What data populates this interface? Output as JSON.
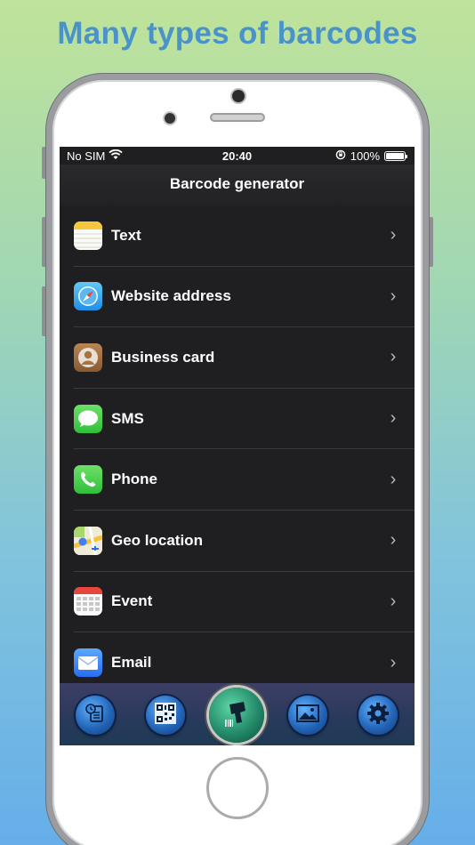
{
  "headline": "Many types of barcodes",
  "status": {
    "carrier": "No SIM",
    "time": "20:40",
    "battery": "100%"
  },
  "nav": {
    "title": "Barcode generator"
  },
  "items": [
    {
      "label": "Text",
      "icon": "notes-icon"
    },
    {
      "label": "Website address",
      "icon": "compass-icon"
    },
    {
      "label": "Business card",
      "icon": "contact-icon"
    },
    {
      "label": "SMS",
      "icon": "message-icon"
    },
    {
      "label": "Phone",
      "icon": "phone-icon"
    },
    {
      "label": "Geo location",
      "icon": "map-icon"
    },
    {
      "label": "Event",
      "icon": "calendar-icon"
    },
    {
      "label": "Email",
      "icon": "mail-icon"
    }
  ],
  "tabs": [
    {
      "name": "history",
      "icon": "history-icon"
    },
    {
      "name": "scan-qr",
      "icon": "qr-code-icon"
    },
    {
      "name": "generate",
      "icon": "barcode-scanner-icon"
    },
    {
      "name": "images",
      "icon": "image-icon"
    },
    {
      "name": "settings",
      "icon": "gear-icon"
    }
  ],
  "colors": {
    "screen_bg": "#1f1f21",
    "accent_headline": "#4a93c9"
  }
}
